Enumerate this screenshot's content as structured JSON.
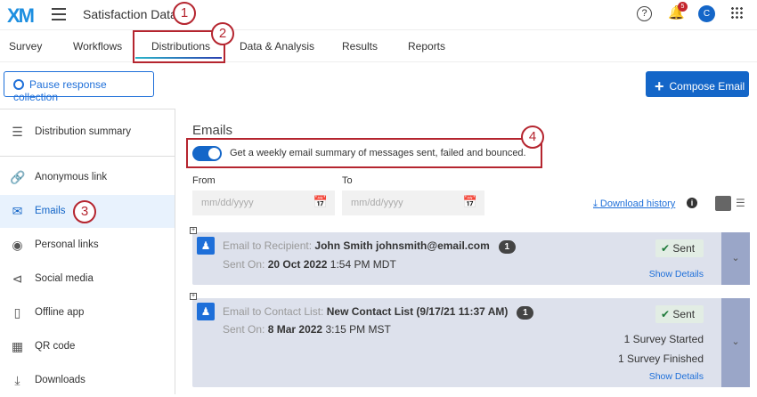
{
  "header": {
    "logo": "XM",
    "title": "Satisfaction Data",
    "notification_count": "5",
    "avatar_initial": "C"
  },
  "tabs": [
    "Survey",
    "Workflows",
    "Distributions",
    "Data & Analysis",
    "Results",
    "Reports"
  ],
  "toolbar": {
    "pause_label": "Pause response collection",
    "compose_label": "Compose Email"
  },
  "sidebar": {
    "items": [
      {
        "label": "Distribution summary",
        "icon": "list-icon"
      },
      {
        "label": "Anonymous link",
        "icon": "link-icon"
      },
      {
        "label": "Emails",
        "icon": "envelope-icon"
      },
      {
        "label": "Personal links",
        "icon": "fingerprint-icon"
      },
      {
        "label": "Social media",
        "icon": "share-icon"
      },
      {
        "label": "Offline app",
        "icon": "phone-icon"
      },
      {
        "label": "QR code",
        "icon": "qr-icon"
      },
      {
        "label": "Downloads",
        "icon": "download-icon"
      }
    ]
  },
  "annotations": [
    "1",
    "2",
    "3",
    "4"
  ],
  "main": {
    "heading": "Emails",
    "toggle_label": "Get a weekly email summary of messages sent, failed and bounced.",
    "toggle_on": true,
    "from_label": "From",
    "to_label": "To",
    "date_placeholder": "mm/dd/yyyy",
    "download_history": "Download history"
  },
  "cards": [
    {
      "type_label": "Email to Recipient:",
      "target": "John Smith johnsmith@email.com",
      "count": "1",
      "sent_on_label": "Sent On:",
      "date": "20 Oct 2022",
      "time": "1:54 PM MDT",
      "status": "Sent",
      "stats": [],
      "details": "Show Details"
    },
    {
      "type_label": "Email to Contact List:",
      "target": "New Contact List (9/17/21 11:37 AM)",
      "count": "1",
      "sent_on_label": "Sent On:",
      "date": "8 Mar 2022",
      "time": "3:15 PM MST",
      "status": "Sent",
      "stats": [
        "1 Survey Started",
        "1 Survey Finished"
      ],
      "details": "Show Details"
    }
  ]
}
